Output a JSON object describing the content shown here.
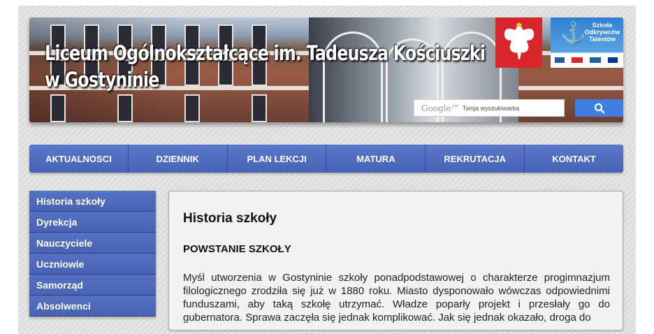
{
  "header": {
    "title_line1": "Liceum Ogólnokształcące im. Tadeusza Kościuszki",
    "title_line2": "w Gostyninie",
    "badge_text": "Szkoła Odkrywców Talentów",
    "search": {
      "brand": "Google™",
      "placeholder": "Twoja wyszukiwarka"
    }
  },
  "nav": {
    "items": [
      "Aktualnosci",
      "Dziennik",
      "Plan lekcji",
      "Matura",
      "Rekrutacja",
      "Kontakt"
    ]
  },
  "sidebar": {
    "items": [
      "Historia szkoły",
      "Dyrekcja",
      "Nauczyciele",
      "Uczniowie",
      "Samorząd",
      "Absolwenci"
    ]
  },
  "content": {
    "title": "Historia szkoły",
    "subtitle": "POWSTANIE SZKOŁY",
    "paragraph": "Myśl utworzenia w Gostyninie szkoły ponadpodstawowej o charakterze progimnazjum filologicznego zrodziła się już w 1880 roku. Miasto dysponowało wówczas odpowiednimi funduszami, aby taką szkołę utrzymać. Władze poparły projekt i przesłały go do gubernatora. Sprawa zaczęła się jednak komplikować. Jak się jednak okazało, droga do"
  },
  "colors": {
    "nav_blue": "#4a66b8",
    "search_button": "#3f7fe0",
    "background_stripe": "#e0e0e0"
  },
  "icons": {
    "search": "magnifier-icon",
    "emblem": "polish-eagle-icon"
  }
}
